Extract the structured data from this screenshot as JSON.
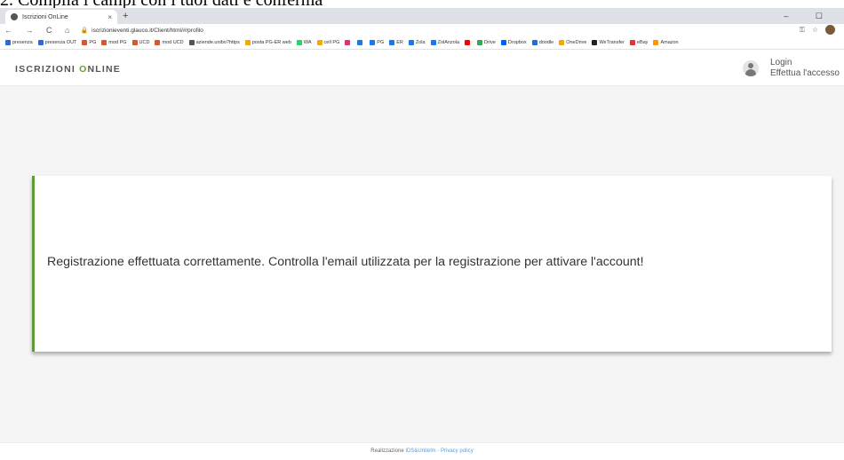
{
  "caption": "2. Compila i campi con i tuoi dati e conferma",
  "browser": {
    "tab_title": "Iscrizioni OnLine",
    "tab_close": "×",
    "new_tab": "+",
    "window_controls": "– ☐",
    "nav_buttons": "← → C ⌂",
    "url": "iscrizionieventi.glauco.it/Client/html/#/profilo",
    "bookmarks": [
      {
        "label": "presenza",
        "color": "#2a6ad8"
      },
      {
        "label": "presenza OUT",
        "color": "#2a6ad8"
      },
      {
        "label": "PG",
        "color": "#d9582b"
      },
      {
        "label": "mod PG",
        "color": "#d9582b"
      },
      {
        "label": "UCD",
        "color": "#d9582b"
      },
      {
        "label": "mod UCD",
        "color": "#d9582b"
      },
      {
        "label": "aziende.unibo?https",
        "color": "#555555"
      },
      {
        "label": "posta PG-ER web",
        "color": "#f2a900"
      },
      {
        "label": "WA",
        "color": "#25d366"
      },
      {
        "label": "cell PG",
        "color": "#f2a900"
      },
      {
        "label": "",
        "color": "#e1306c"
      },
      {
        "label": "",
        "color": "#1d7bd8"
      },
      {
        "label": "PG",
        "color": "#1877f2"
      },
      {
        "label": "ER",
        "color": "#1877f2"
      },
      {
        "label": "Zola",
        "color": "#1877f2"
      },
      {
        "label": "ZolAnzola",
        "color": "#1877f2"
      },
      {
        "label": "",
        "color": "#ff0000"
      },
      {
        "label": "Drive",
        "color": "#34a853"
      },
      {
        "label": "Dropbox",
        "color": "#0061ff"
      },
      {
        "label": "doodle",
        "color": "#1d6fd6"
      },
      {
        "label": "OneDrive",
        "color": "#f2a900"
      },
      {
        "label": "WeTransfer",
        "color": "#222222"
      },
      {
        "label": "eBay",
        "color": "#e53238"
      },
      {
        "label": "Amazon",
        "color": "#ff9900"
      }
    ]
  },
  "app": {
    "brand_prefix": "ISCRIZIONI ",
    "brand_o": "O",
    "brand_suffix": "NLINE",
    "login_label": "Login",
    "login_sub": "Effettua l'accesso",
    "colors": {
      "accent": "#6a9a3a",
      "card_border": "#5e9a3c"
    }
  },
  "message": "Registrazione effettuata correttamente. Controlla l'email utilizzata per la registrazione per attivare l'account!",
  "footer": {
    "prefix": "Realizzazione",
    "link1": "IDS&Unitelm",
    "sep": "-",
    "link2": "Privacy policy"
  }
}
